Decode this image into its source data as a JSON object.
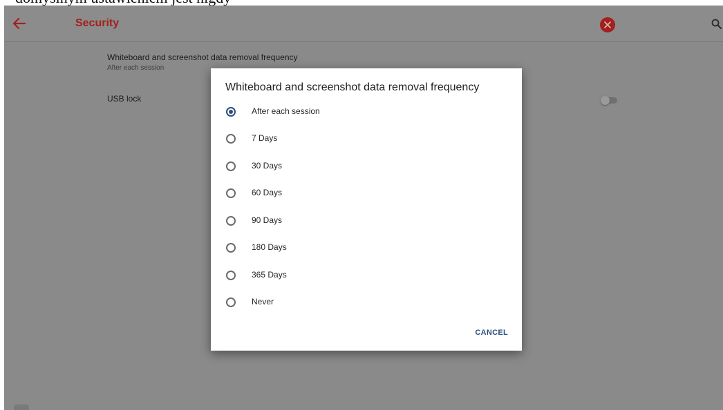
{
  "caption": "domyślnym ustawieniem jest nigdy",
  "appbar": {
    "title": "Security",
    "back_icon": "arrow-left-icon",
    "close_icon": "close-circle-icon",
    "search_icon": "search-icon",
    "accent_color": "#a3201c"
  },
  "settings": {
    "whiteboard": {
      "title": "Whiteboard and screenshot data removal frequency",
      "value": "After each session"
    },
    "usb_lock": {
      "title": "USB lock",
      "enabled": false
    }
  },
  "dialog": {
    "title": "Whiteboard and screenshot data removal frequency",
    "selected": "After each session",
    "options": [
      "After each session",
      "7 Days",
      "30 Days",
      "60 Days",
      "90 Days",
      "180 Days",
      "365 Days",
      "Never"
    ],
    "cancel_label": "CANCEL",
    "accent_color": "#2a4f7c"
  }
}
